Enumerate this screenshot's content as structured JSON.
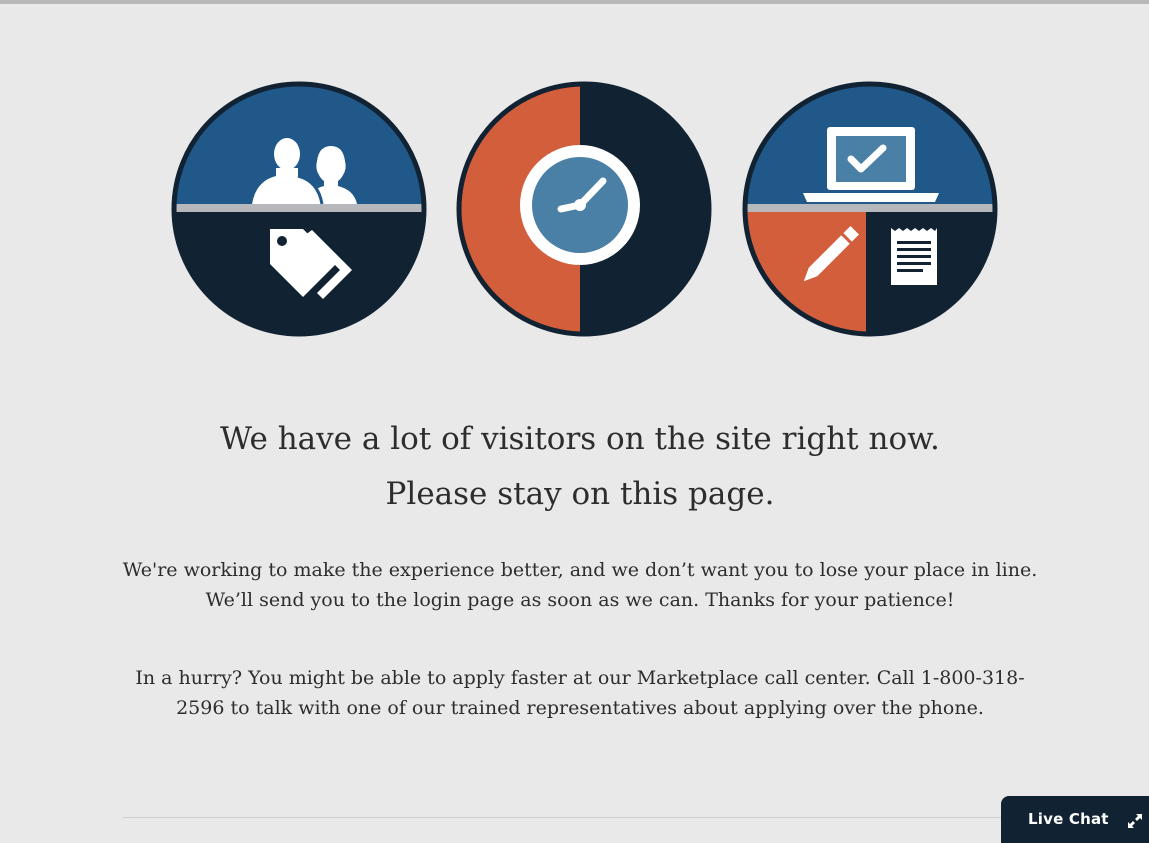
{
  "heading": {
    "line1": "We have a lot of visitors on the site right now.",
    "line2": "Please stay on this page."
  },
  "body": {
    "paragraph1": "We're working to make the experience better, and we don’t want you to lose your place in line. We’ll send you to the login page as soon as we can. Thanks for your patience!",
    "paragraph2": "In a hurry? You might be able to apply faster at our Marketplace call center. Call 1-800-318-2596 to talk with one of our trained representatives about applying over the phone."
  },
  "live_chat": {
    "label": "Live Chat",
    "icon": "expand-icon"
  },
  "illustrations": {
    "left": {
      "icons": [
        "people-icon",
        "price-tag-icon"
      ]
    },
    "center": {
      "icons": [
        "clock-icon"
      ]
    },
    "right": {
      "icons": [
        "laptop-checkmark-icon",
        "pencil-icon",
        "document-icon"
      ]
    }
  },
  "colors": {
    "background": "#e9e9ea",
    "navy": "#112233",
    "blue": "#205989",
    "orange": "#d35e3b",
    "gray_band": "#b6b8bb",
    "clock_face": "#4a7fa6",
    "text": "#2d2d2d"
  }
}
